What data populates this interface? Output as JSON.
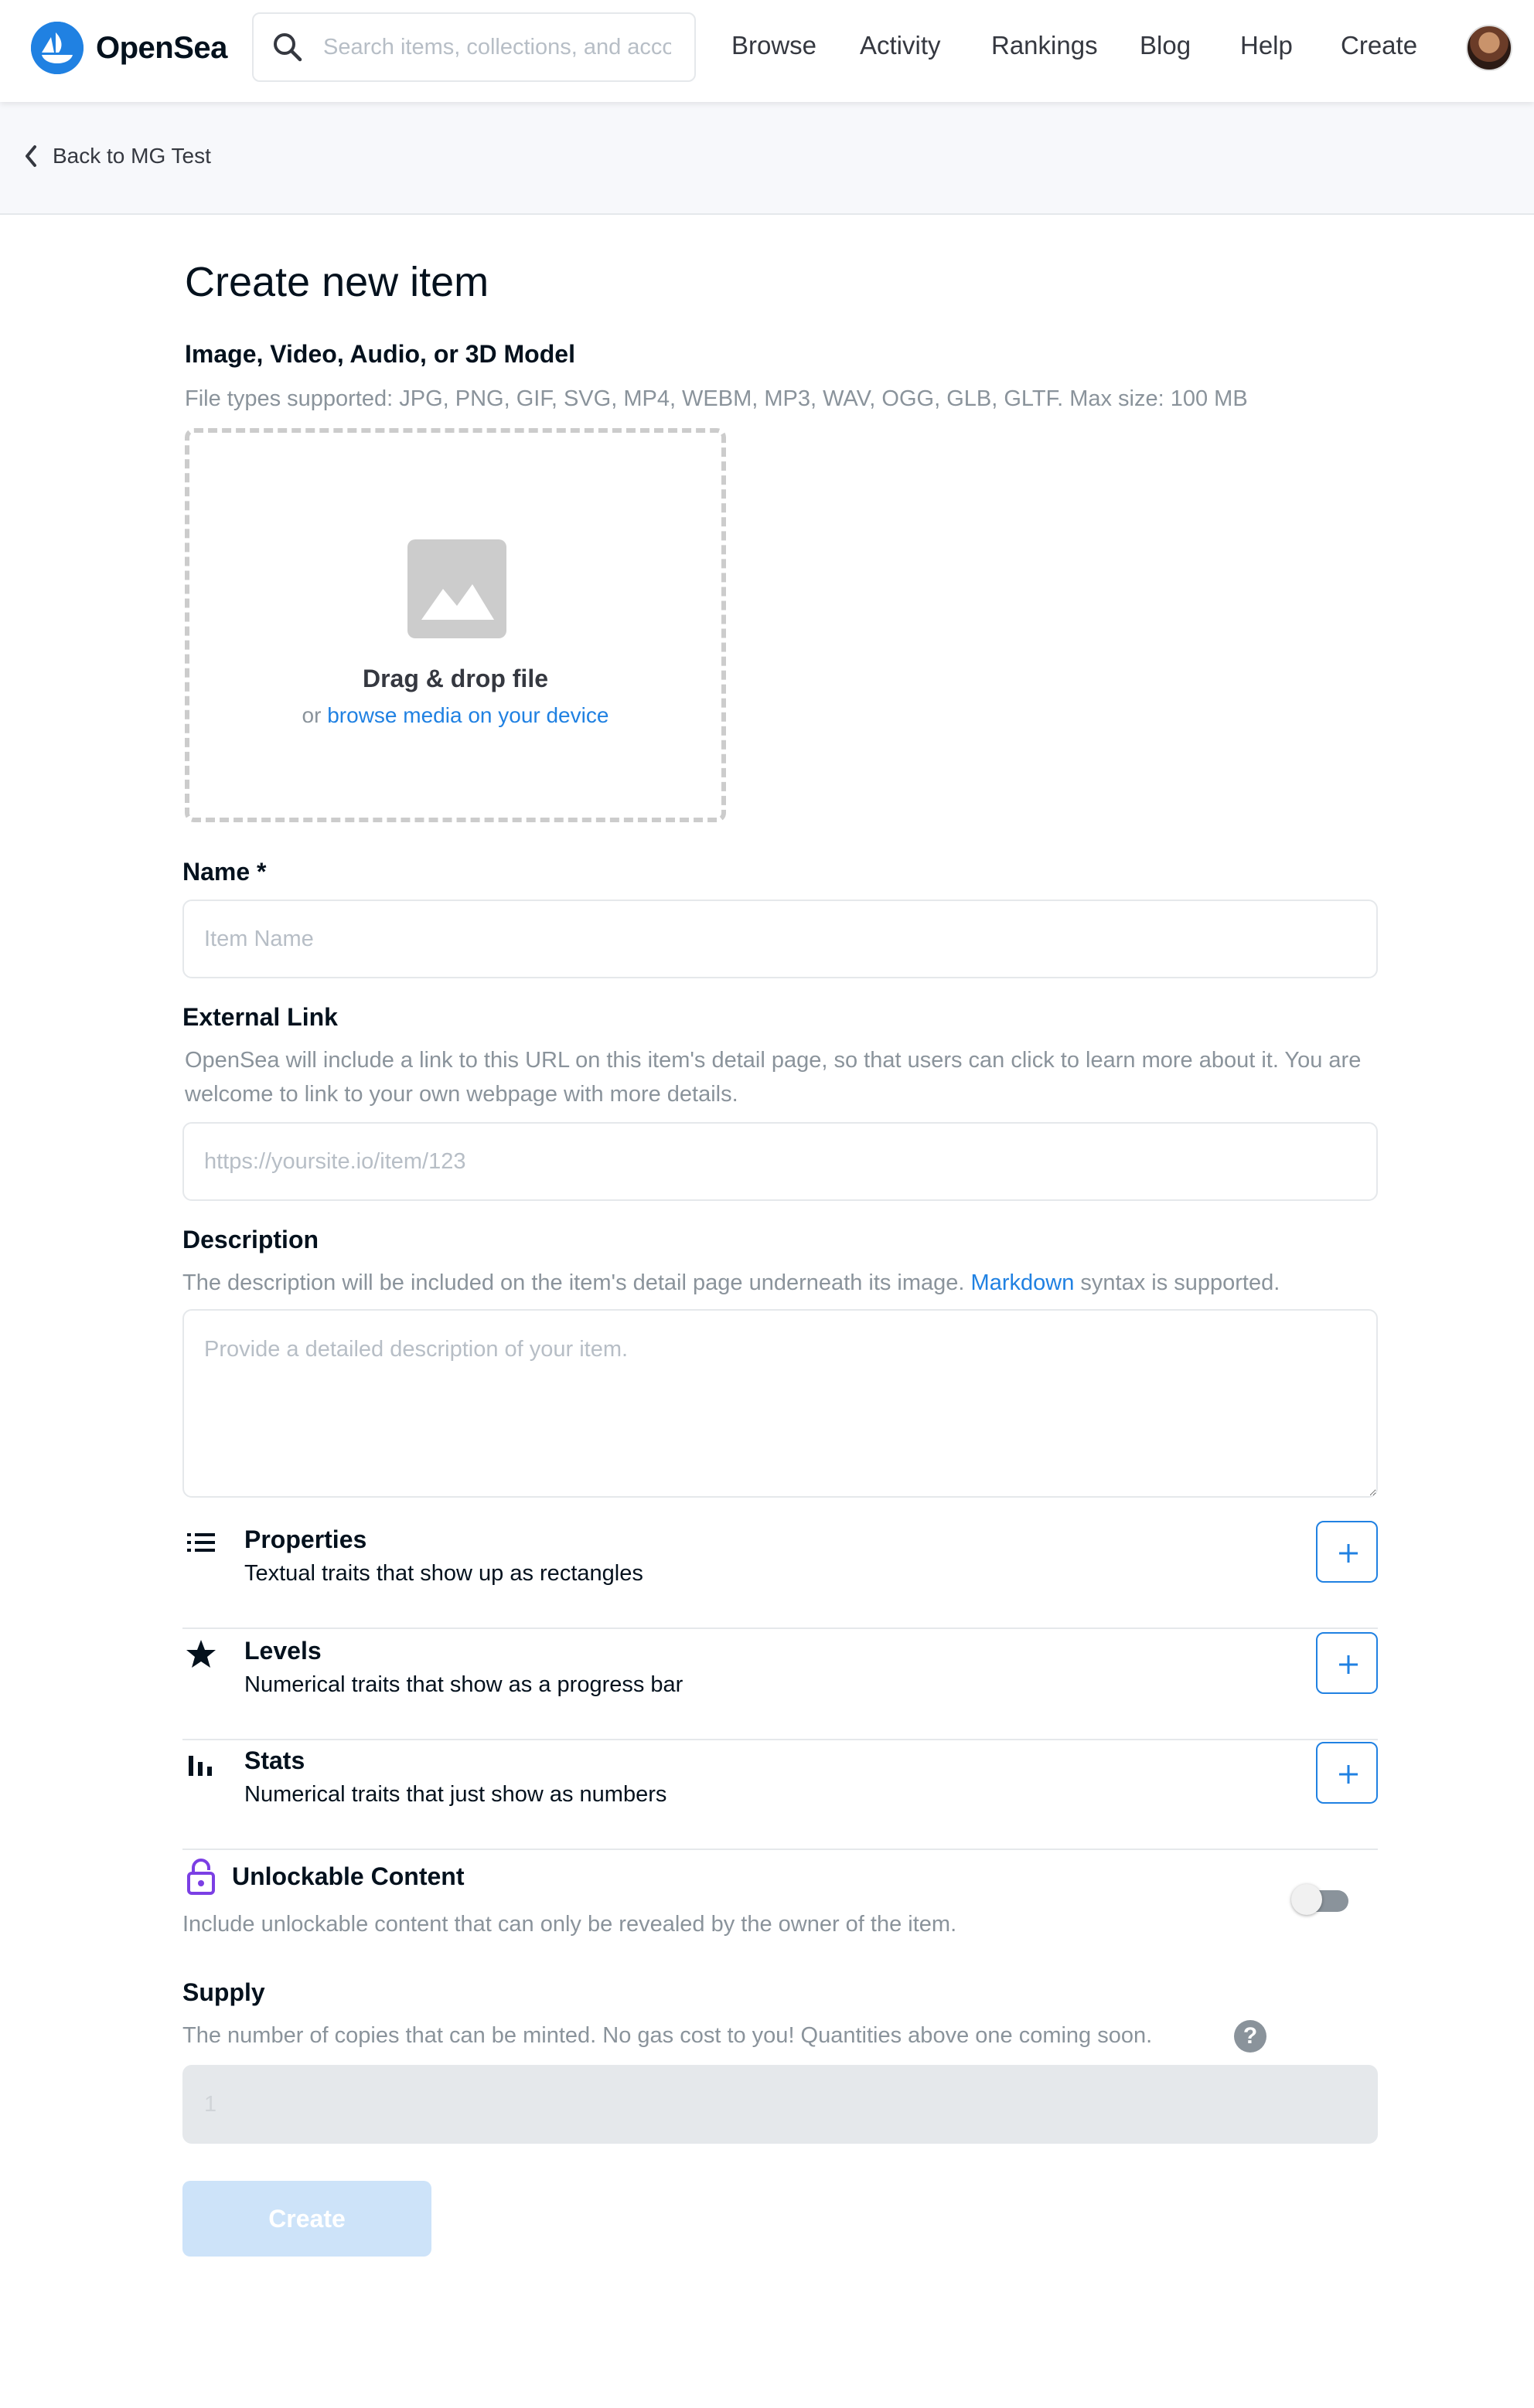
{
  "header": {
    "logo_text": "OpenSea",
    "search": {
      "placeholder": "Search items, collections, and accounts",
      "value": ""
    },
    "nav": [
      "Browse",
      "Activity",
      "Rankings",
      "Blog",
      "Help",
      "Create"
    ]
  },
  "back": {
    "label": "Back to MG Test"
  },
  "form": {
    "title": "Create new item",
    "media": {
      "label": "Image, Video, Audio, or 3D Model",
      "hint": "File types supported: JPG, PNG, GIF, SVG, MP4, WEBM, MP3, WAV, OGG, GLB, GLTF. Max size: 100 MB",
      "drop_title": "Drag & drop file",
      "drop_or": "or",
      "drop_link": "browse media on your device"
    },
    "name": {
      "label": "Name *",
      "placeholder": "Item Name",
      "value": ""
    },
    "external_link": {
      "label": "External Link",
      "hint": "OpenSea will include a link to this URL on this item's detail page, so that users can click to learn more about it. You are welcome to link to your own webpage with more details.",
      "placeholder": "https://yoursite.io/item/123",
      "value": ""
    },
    "description": {
      "label": "Description",
      "hint_before": "The description will be included on the item's detail page underneath its image.",
      "hint_link": "Markdown",
      "hint_after": "syntax is supported.",
      "placeholder": "Provide a detailed description of your item.",
      "value": ""
    },
    "traits": [
      {
        "icon": "list-icon",
        "title": "Properties",
        "desc": "Textual traits that show up as rectangles"
      },
      {
        "icon": "star-icon",
        "title": "Levels",
        "desc": "Numerical traits that show as a progress bar"
      },
      {
        "icon": "bar-chart-icon",
        "title": "Stats",
        "desc": "Numerical traits that just show as numbers"
      }
    ],
    "unlockable": {
      "title": "Unlockable Content",
      "desc": "Include unlockable content that can only be revealed by the owner of the item.",
      "enabled": false
    },
    "supply": {
      "label": "Supply",
      "hint": "The number of copies that can be minted. No gas cost to you! Quantities above one coming soon.",
      "help_glyph": "?",
      "placeholder": "1"
    },
    "create_label": "Create"
  },
  "colors": {
    "accent": "#2081e2",
    "muted": "#8a939b",
    "border": "#e5e8eb",
    "disabled_button": "#cde3f9"
  }
}
